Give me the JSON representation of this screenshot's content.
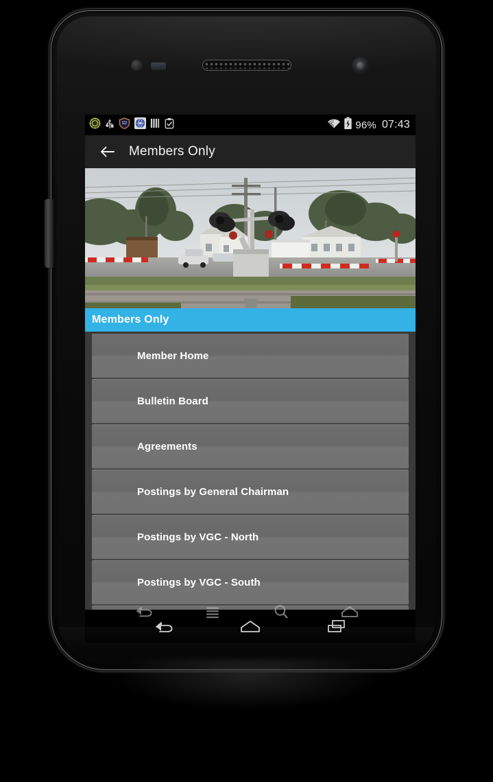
{
  "status_bar": {
    "left_icons": [
      {
        "name": "app-badge-icon",
        "glyph": "gear-badge"
      },
      {
        "name": "usb-icon",
        "glyph": "usb"
      },
      {
        "name": "shield-badge-icon",
        "glyph": "shield"
      },
      {
        "name": "globe-sync-icon",
        "glyph": "globe"
      },
      {
        "name": "signal-bars-icon",
        "glyph": "bars"
      },
      {
        "name": "clipboard-check-icon",
        "glyph": "clipboard"
      }
    ],
    "wifi_icon": "wifi-icon",
    "battery_icon": "battery-charging-icon",
    "battery_percent": "96%",
    "clock": "07:43"
  },
  "action_bar": {
    "back_icon": "back-arrow-icon",
    "title": "Members Only"
  },
  "hero": {
    "alt": "railroad-crossing-photo"
  },
  "section_header": {
    "label": "Members Only",
    "color": "#33b2e6"
  },
  "menu": {
    "items": [
      {
        "label": "Member Home"
      },
      {
        "label": "Bulletin Board"
      },
      {
        "label": "Agreements"
      },
      {
        "label": "Postings by General Chairman"
      },
      {
        "label": "Postings by VGC - North"
      },
      {
        "label": "Postings by VGC - South"
      },
      {
        "label": ""
      }
    ]
  },
  "nav_bar": {
    "buttons": [
      {
        "name": "nav-back-button",
        "icon": "back-icon"
      },
      {
        "name": "nav-home-button",
        "icon": "home-icon"
      },
      {
        "name": "nav-recents-button",
        "icon": "recents-icon"
      }
    ]
  },
  "capacitive_bar": {
    "buttons": [
      {
        "name": "capacitive-back-button",
        "icon": "back-icon"
      },
      {
        "name": "capacitive-menu-button",
        "icon": "menu-icon"
      },
      {
        "name": "capacitive-search-button",
        "icon": "search-icon"
      },
      {
        "name": "capacitive-home-button",
        "icon": "home-icon"
      }
    ]
  },
  "theme": {
    "accent": "#33b2e6",
    "action_bar_bg": "#222222",
    "list_item_bg": "#6e6e6e",
    "list_bg": "#3a3a3a"
  }
}
